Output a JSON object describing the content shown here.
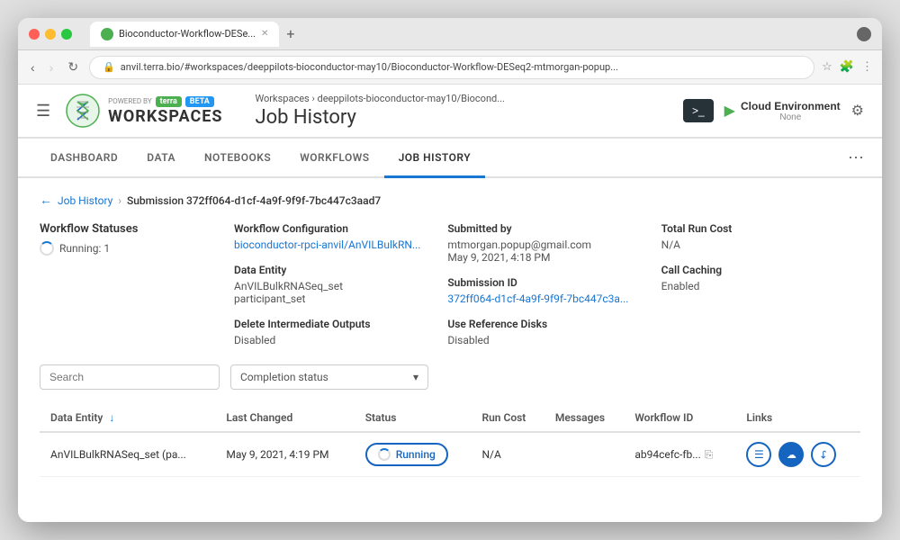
{
  "window": {
    "tab_favicon": "●",
    "tab_title": "Bioconductor-Workflow-DESe...",
    "address_bar": "anvil.terra.bio/#workspaces/deeppilots-bioconductor-may10/Bioconductor-Workflow-DESeq2-mtmorgan-popup..."
  },
  "header": {
    "hamburger": "☰",
    "powered_by": "POWERED BY",
    "terra_label": "terra",
    "beta_label": "BETA",
    "workspaces_label": "WORKSPACES",
    "breadcrumb_workspace": "Workspaces",
    "breadcrumb_separator": "›",
    "breadcrumb_project": "deeppilots-bioconductor-may10/Biocond...",
    "page_title": "Job History",
    "terminal_label": ">_",
    "cloud_env_label": "Cloud Environment",
    "cloud_env_sub": "None",
    "gear_icon": "⚙"
  },
  "nav": {
    "tabs": [
      {
        "id": "dashboard",
        "label": "DASHBOARD",
        "active": false
      },
      {
        "id": "data",
        "label": "DATA",
        "active": false
      },
      {
        "id": "notebooks",
        "label": "NOTEBOOKS",
        "active": false
      },
      {
        "id": "workflows",
        "label": "WORKFLOWS",
        "active": false
      },
      {
        "id": "job-history",
        "label": "JOB HISTORY",
        "active": true
      }
    ],
    "more_icon": "⋯"
  },
  "breadcrumb": {
    "back_arrow": "←",
    "job_history": "Job History",
    "separator": "›",
    "submission_id": "Submission 372ff064-d1cf-4a9f-9f9f-7bc447c3aad7"
  },
  "workflow_statuses": {
    "title": "Workflow Statuses",
    "running_label": "Running: 1"
  },
  "info_fields": {
    "workflow_config_label": "Workflow Configuration",
    "workflow_config_value": "bioconductor-rpci-anvil/AnVILBulkRN...",
    "submitted_by_label": "Submitted by",
    "submitted_by_email": "mtmorgan.popup@gmail.com",
    "submitted_by_date": "May 9, 2021, 4:18 PM",
    "total_run_cost_label": "Total Run Cost",
    "total_run_cost_value": "N/A",
    "data_entity_label": "Data Entity",
    "data_entity_value1": "AnVILBulkRNASeq_set",
    "data_entity_value2": "participant_set",
    "submission_id_label": "Submission ID",
    "submission_id_value": "372ff064-d1cf-4a9f-9f9f-7bc447c3a...",
    "call_caching_label": "Call Caching",
    "call_caching_value": "Enabled",
    "delete_intermediate_label": "Delete Intermediate Outputs",
    "delete_intermediate_value": "Disabled",
    "use_reference_label": "Use Reference Disks",
    "use_reference_value": "Disabled"
  },
  "filters": {
    "search_placeholder": "Search",
    "completion_status_label": "Completion status",
    "dropdown_arrow": "▾"
  },
  "table": {
    "columns": [
      {
        "id": "data-entity",
        "label": "Data Entity",
        "sortable": true,
        "sort_icon": "↓"
      },
      {
        "id": "last-changed",
        "label": "Last Changed",
        "sortable": false
      },
      {
        "id": "status",
        "label": "Status",
        "sortable": false
      },
      {
        "id": "run-cost",
        "label": "Run Cost",
        "sortable": false
      },
      {
        "id": "messages",
        "label": "Messages",
        "sortable": false
      },
      {
        "id": "workflow-id",
        "label": "Workflow ID",
        "sortable": false
      },
      {
        "id": "links",
        "label": "Links",
        "sortable": false
      }
    ],
    "rows": [
      {
        "data_entity": "AnVILBulkRNASeq_set (pa...",
        "last_changed": "May 9, 2021, 4:19 PM",
        "status": "Running",
        "run_cost": "N/A",
        "messages": "",
        "workflow_id": "ab94cefc-fb...",
        "has_links": true
      }
    ]
  },
  "icons": {
    "list_icon": "≡",
    "cloud_icon": "☁",
    "export_icon": "⎋",
    "copy_icon": "⎘",
    "running_spin": "↻"
  }
}
